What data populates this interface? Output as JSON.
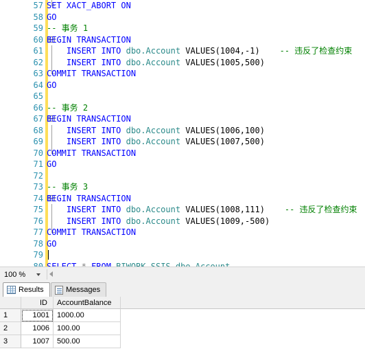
{
  "editor": {
    "lines": [
      {
        "num": "57",
        "indent": 0,
        "changed": true,
        "outline": "end-top",
        "tokens": [
          {
            "t": "SET XACT_ABORT ON",
            "c": "kw"
          }
        ]
      },
      {
        "num": "58",
        "indent": 0,
        "changed": true,
        "outline": "none",
        "tokens": [
          {
            "t": "GO",
            "c": "kw"
          }
        ]
      },
      {
        "num": "59",
        "indent": 0,
        "changed": true,
        "outline": "none",
        "tokens": [
          {
            "t": "-- 事务 1",
            "c": "cmt"
          }
        ]
      },
      {
        "num": "60",
        "indent": 0,
        "changed": true,
        "outline": "box",
        "tokens": [
          {
            "t": "BEGIN TRANSACTION",
            "c": "kw"
          }
        ]
      },
      {
        "num": "61",
        "indent": 0,
        "changed": true,
        "outline": "vline",
        "tokens": [
          {
            "t": "    INSERT INTO ",
            "c": "kw"
          },
          {
            "t": "dbo.Account ",
            "c": "obj"
          },
          {
            "t": "VALUES",
            "c": "plain"
          },
          {
            "t": "(",
            "c": "plain"
          },
          {
            "t": "1004",
            "c": "num"
          },
          {
            "t": ",",
            "c": "plain"
          },
          {
            "t": "-1",
            "c": "num"
          },
          {
            "t": ")",
            "c": "plain"
          },
          {
            "t": "    -- 违反了检查约束",
            "c": "cmt"
          }
        ]
      },
      {
        "num": "62",
        "indent": 0,
        "changed": true,
        "outline": "vline",
        "tokens": [
          {
            "t": "    INSERT INTO ",
            "c": "kw"
          },
          {
            "t": "dbo.Account ",
            "c": "obj"
          },
          {
            "t": "VALUES",
            "c": "plain"
          },
          {
            "t": "(",
            "c": "plain"
          },
          {
            "t": "1005",
            "c": "num"
          },
          {
            "t": ",",
            "c": "plain"
          },
          {
            "t": "500",
            "c": "num"
          },
          {
            "t": ")",
            "c": "plain"
          }
        ]
      },
      {
        "num": "63",
        "indent": 0,
        "changed": true,
        "outline": "end",
        "tokens": [
          {
            "t": "COMMIT TRANSACTION",
            "c": "kw"
          }
        ]
      },
      {
        "num": "64",
        "indent": 0,
        "changed": true,
        "outline": "none",
        "tokens": [
          {
            "t": "GO",
            "c": "kw"
          }
        ]
      },
      {
        "num": "65",
        "indent": 0,
        "changed": true,
        "outline": "none",
        "tokens": []
      },
      {
        "num": "66",
        "indent": 0,
        "changed": true,
        "outline": "none",
        "tokens": [
          {
            "t": "-- 事务 2",
            "c": "cmt"
          }
        ]
      },
      {
        "num": "67",
        "indent": 0,
        "changed": true,
        "outline": "box",
        "tokens": [
          {
            "t": "BEGIN TRANSACTION",
            "c": "kw"
          }
        ]
      },
      {
        "num": "68",
        "indent": 0,
        "changed": true,
        "outline": "vline",
        "tokens": [
          {
            "t": "    INSERT INTO ",
            "c": "kw"
          },
          {
            "t": "dbo.Account ",
            "c": "obj"
          },
          {
            "t": "VALUES",
            "c": "plain"
          },
          {
            "t": "(",
            "c": "plain"
          },
          {
            "t": "1006",
            "c": "num"
          },
          {
            "t": ",",
            "c": "plain"
          },
          {
            "t": "100",
            "c": "num"
          },
          {
            "t": ")",
            "c": "plain"
          }
        ]
      },
      {
        "num": "69",
        "indent": 0,
        "changed": true,
        "outline": "vline",
        "tokens": [
          {
            "t": "    INSERT INTO ",
            "c": "kw"
          },
          {
            "t": "dbo.Account ",
            "c": "obj"
          },
          {
            "t": "VALUES",
            "c": "plain"
          },
          {
            "t": "(",
            "c": "plain"
          },
          {
            "t": "1007",
            "c": "num"
          },
          {
            "t": ",",
            "c": "plain"
          },
          {
            "t": "500",
            "c": "num"
          },
          {
            "t": ")",
            "c": "plain"
          }
        ]
      },
      {
        "num": "70",
        "indent": 0,
        "changed": true,
        "outline": "end",
        "tokens": [
          {
            "t": "COMMIT TRANSACTION",
            "c": "kw"
          }
        ]
      },
      {
        "num": "71",
        "indent": 0,
        "changed": true,
        "outline": "none",
        "tokens": [
          {
            "t": "GO",
            "c": "kw"
          }
        ]
      },
      {
        "num": "72",
        "indent": 0,
        "changed": true,
        "outline": "none",
        "tokens": []
      },
      {
        "num": "73",
        "indent": 0,
        "changed": true,
        "outline": "none",
        "tokens": [
          {
            "t": "-- 事务 3",
            "c": "cmt"
          }
        ]
      },
      {
        "num": "74",
        "indent": 0,
        "changed": true,
        "outline": "box",
        "tokens": [
          {
            "t": "BEGIN TRANSACTION",
            "c": "kw"
          }
        ]
      },
      {
        "num": "75",
        "indent": 0,
        "changed": true,
        "outline": "vline",
        "tokens": [
          {
            "t": "    INSERT INTO ",
            "c": "kw"
          },
          {
            "t": "dbo.Account ",
            "c": "obj"
          },
          {
            "t": "VALUES",
            "c": "plain"
          },
          {
            "t": "(",
            "c": "plain"
          },
          {
            "t": "1008",
            "c": "num"
          },
          {
            "t": ",",
            "c": "plain"
          },
          {
            "t": "111",
            "c": "num"
          },
          {
            "t": ")",
            "c": "plain"
          },
          {
            "t": "    -- 违反了检查约束",
            "c": "cmt"
          }
        ]
      },
      {
        "num": "76",
        "indent": 0,
        "changed": true,
        "outline": "vline",
        "tokens": [
          {
            "t": "    INSERT INTO ",
            "c": "kw"
          },
          {
            "t": "dbo.Account ",
            "c": "obj"
          },
          {
            "t": "VALUES",
            "c": "plain"
          },
          {
            "t": "(",
            "c": "plain"
          },
          {
            "t": "1009",
            "c": "num"
          },
          {
            "t": ",",
            "c": "plain"
          },
          {
            "t": "-500",
            "c": "num"
          },
          {
            "t": ")",
            "c": "plain"
          }
        ]
      },
      {
        "num": "77",
        "indent": 0,
        "changed": true,
        "outline": "end",
        "tokens": [
          {
            "t": "COMMIT TRANSACTION",
            "c": "kw"
          }
        ]
      },
      {
        "num": "78",
        "indent": 0,
        "changed": true,
        "outline": "none",
        "tokens": [
          {
            "t": "GO",
            "c": "kw"
          }
        ]
      },
      {
        "num": "79",
        "indent": 0,
        "changed": true,
        "outline": "none",
        "caret": true,
        "tokens": []
      },
      {
        "num": "80",
        "indent": 0,
        "changed": true,
        "outline": "none",
        "tokens": [
          {
            "t": "SELECT ",
            "c": "kw"
          },
          {
            "t": "*",
            "c": "star"
          },
          {
            "t": " FROM ",
            "c": "kw"
          },
          {
            "t": "BIWORK_SSIS.dbo.Account",
            "c": "obj"
          }
        ]
      }
    ]
  },
  "zoombar": {
    "zoom_level": "100 %",
    "dropdown_icon": "chevron-down-icon",
    "scroll_left_icon": "scroll-left-arrow-icon"
  },
  "results": {
    "tabs": [
      {
        "label": "Results",
        "icon": "grid-icon",
        "active": true
      },
      {
        "label": "Messages",
        "icon": "message-icon",
        "active": false
      }
    ],
    "columns": [
      "",
      "ID",
      "AccountBalance"
    ],
    "rows": [
      {
        "n": "1",
        "id": "1001",
        "balance": "1000.00"
      },
      {
        "n": "2",
        "id": "1006",
        "balance": "100.00"
      },
      {
        "n": "3",
        "id": "1007",
        "balance": "500.00"
      }
    ],
    "selected_cell": {
      "row": 0,
      "column": "ID",
      "value": "1001"
    }
  },
  "colors": {
    "keyword": "#0000ff",
    "object": "#2b8a8a",
    "comment": "#008000",
    "line_number": "#2b91af",
    "change_bar": "#fede5a"
  }
}
